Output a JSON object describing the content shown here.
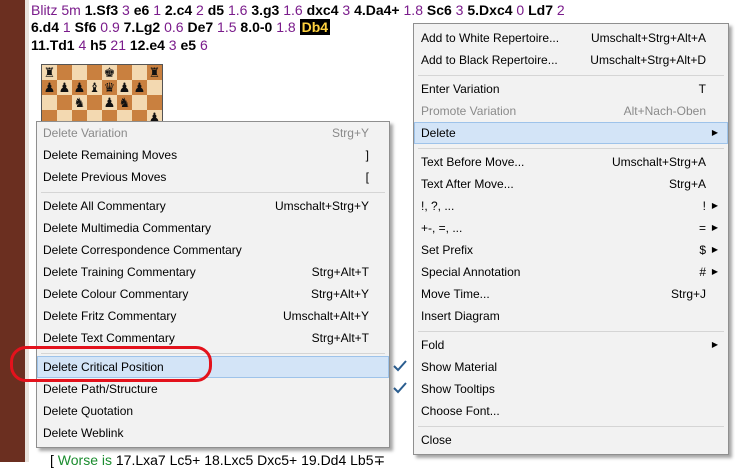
{
  "notation": {
    "line1": [
      {
        "t": "Blitz 5m ",
        "k": "head"
      },
      {
        "t": "1.Sf3",
        "k": "mv"
      },
      {
        "t": " 3 ",
        "k": "ev"
      },
      {
        "t": "e6",
        "k": "mv"
      },
      {
        "t": " 1 ",
        "k": "ev"
      },
      {
        "t": "2.c4",
        "k": "mv"
      },
      {
        "t": " 2 ",
        "k": "ev"
      },
      {
        "t": "d5",
        "k": "mv"
      },
      {
        "t": " 1.6 ",
        "k": "ev"
      },
      {
        "t": "3.g3",
        "k": "mv"
      },
      {
        "t": " 1.6 ",
        "k": "ev"
      },
      {
        "t": "dxc4",
        "k": "mv"
      },
      {
        "t": " 3 ",
        "k": "ev"
      },
      {
        "t": "4.Da4+",
        "k": "mv"
      },
      {
        "t": " 1.8 ",
        "k": "ev"
      },
      {
        "t": "Sc6",
        "k": "mv"
      },
      {
        "t": " 3 ",
        "k": "ev"
      },
      {
        "t": "5.Dxc4",
        "k": "mv"
      },
      {
        "t": " 0 ",
        "k": "ev"
      },
      {
        "t": "Ld7",
        "k": "mv"
      },
      {
        "t": " 2",
        "k": "ev"
      }
    ],
    "line2": [
      {
        "t": "6.d4",
        "k": "mv"
      },
      {
        "t": " 1 ",
        "k": "ev"
      },
      {
        "t": "Sf6",
        "k": "mv"
      },
      {
        "t": " 0.9 ",
        "k": "ev"
      },
      {
        "t": "7.Lg2",
        "k": "mv"
      },
      {
        "t": " 0.6 ",
        "k": "ev"
      },
      {
        "t": "De7",
        "k": "mv"
      },
      {
        "t": " 1.5 ",
        "k": "ev"
      },
      {
        "t": "8.0-0",
        "k": "mv"
      },
      {
        "t": " 1.8 ",
        "k": "ev"
      },
      {
        "t": "Db4",
        "k": "hl"
      }
    ],
    "line3": [
      {
        "t": "11.Td1",
        "k": "mv"
      },
      {
        "t": " 4 ",
        "k": "ev"
      },
      {
        "t": "h5",
        "k": "mv"
      },
      {
        "t": " 21 ",
        "k": "ev"
      },
      {
        "t": "12.e4",
        "k": "mv"
      },
      {
        "t": " 3 ",
        "k": "ev"
      },
      {
        "t": "e5",
        "k": "mv"
      },
      {
        "t": " 6",
        "k": "ev"
      }
    ],
    "bottom": {
      "open": "[ ",
      "worse": "Worse is",
      "rest": " 17.Lxa7 Lc5+ 18.Lxc5 Dxc5+ 19.Dd4 Lb5∓"
    }
  },
  "board": {
    "rows": [
      [
        "♜",
        "",
        "",
        "",
        "♚",
        "",
        "",
        "♜"
      ],
      [
        "♟",
        "♟",
        "♟",
        "♝",
        "♛",
        "♟",
        "♟",
        ""
      ],
      [
        "",
        "",
        "♞",
        "",
        "♟",
        "♞",
        "",
        ""
      ],
      [
        "",
        "",
        "",
        "",
        "",
        "",
        "",
        "♟"
      ],
      [
        "",
        "",
        "",
        "♙",
        "♙",
        "",
        "",
        ""
      ],
      [
        "",
        "",
        "",
        "",
        "",
        "",
        "♙",
        ""
      ],
      [
        "♙",
        "♙",
        "",
        "",
        "",
        "♙",
        "♗",
        "♙"
      ],
      [
        "♖",
        "♘",
        "♗",
        "♖",
        "",
        "",
        "♔",
        ""
      ]
    ]
  },
  "context_menu": {
    "items": [
      {
        "label": "Add to White Repertoire...",
        "shortcut": "Umschalt+Strg+Alt+A"
      },
      {
        "label": "Add to Black Repertoire...",
        "shortcut": "Umschalt+Strg+Alt+D"
      },
      {
        "sep": true
      },
      {
        "label": "Enter Variation",
        "shortcut": "T"
      },
      {
        "label": "Promote Variation",
        "shortcut": "Alt+Nach-Oben",
        "disabled": true
      },
      {
        "label": "Delete",
        "shortcut": "",
        "submenu": true,
        "hover": true
      },
      {
        "sep": true
      },
      {
        "label": "Text Before Move...",
        "shortcut": "Umschalt+Strg+A"
      },
      {
        "label": "Text After Move...",
        "shortcut": "Strg+A"
      },
      {
        "label": "!, ?, ...",
        "shortcut": "!",
        "submenu": true
      },
      {
        "label": "+-, =, ...",
        "shortcut": "=",
        "submenu": true
      },
      {
        "label": "Set Prefix",
        "shortcut": "$",
        "submenu": true
      },
      {
        "label": "Special Annotation",
        "shortcut": "#",
        "submenu": true
      },
      {
        "label": "Move Time...",
        "shortcut": "Strg+J"
      },
      {
        "label": "Insert Diagram",
        "shortcut": ""
      },
      {
        "sep": true
      },
      {
        "label": "Fold",
        "shortcut": "",
        "submenu": true
      },
      {
        "label": "Show Material",
        "shortcut": "",
        "checked": true
      },
      {
        "label": "Show Tooltips",
        "shortcut": "",
        "checked": true
      },
      {
        "label": "Choose Font...",
        "shortcut": ""
      },
      {
        "sep": true
      },
      {
        "label": "Close",
        "shortcut": ""
      }
    ]
  },
  "delete_submenu": {
    "items": [
      {
        "label": "Delete Variation",
        "shortcut": "Strg+Y",
        "disabled": true
      },
      {
        "label": "Delete Remaining Moves",
        "shortcut": "]"
      },
      {
        "label": "Delete Previous Moves",
        "shortcut": "["
      },
      {
        "sep": true
      },
      {
        "label": "Delete All Commentary",
        "shortcut": "Umschalt+Strg+Y"
      },
      {
        "label": "Delete Multimedia Commentary",
        "shortcut": ""
      },
      {
        "label": "Delete Correspondence Commentary",
        "shortcut": ""
      },
      {
        "label": "Delete Training Commentary",
        "shortcut": "Strg+Alt+T"
      },
      {
        "label": "Delete Colour Commentary",
        "shortcut": "Strg+Alt+Y"
      },
      {
        "label": "Delete Fritz Commentary",
        "shortcut": "Umschalt+Alt+Y"
      },
      {
        "label": "Delete Text Commentary",
        "shortcut": "Strg+Alt+T"
      },
      {
        "sep": true
      },
      {
        "label": "Delete Critical Position",
        "shortcut": "",
        "hover": true
      },
      {
        "label": "Delete Path/Structure",
        "shortcut": ""
      },
      {
        "label": "Delete Quotation",
        "shortcut": ""
      },
      {
        "label": "Delete Weblink",
        "shortcut": ""
      }
    ]
  },
  "colors": {
    "hover_bg": "#d3e4f7",
    "menu_bg": "#f2f2f2",
    "annotation_red": "#e3121c",
    "eval_purple": "#7a1b8b",
    "worse_green": "#1a8c2e",
    "check_blue": "#2a5d8f"
  }
}
